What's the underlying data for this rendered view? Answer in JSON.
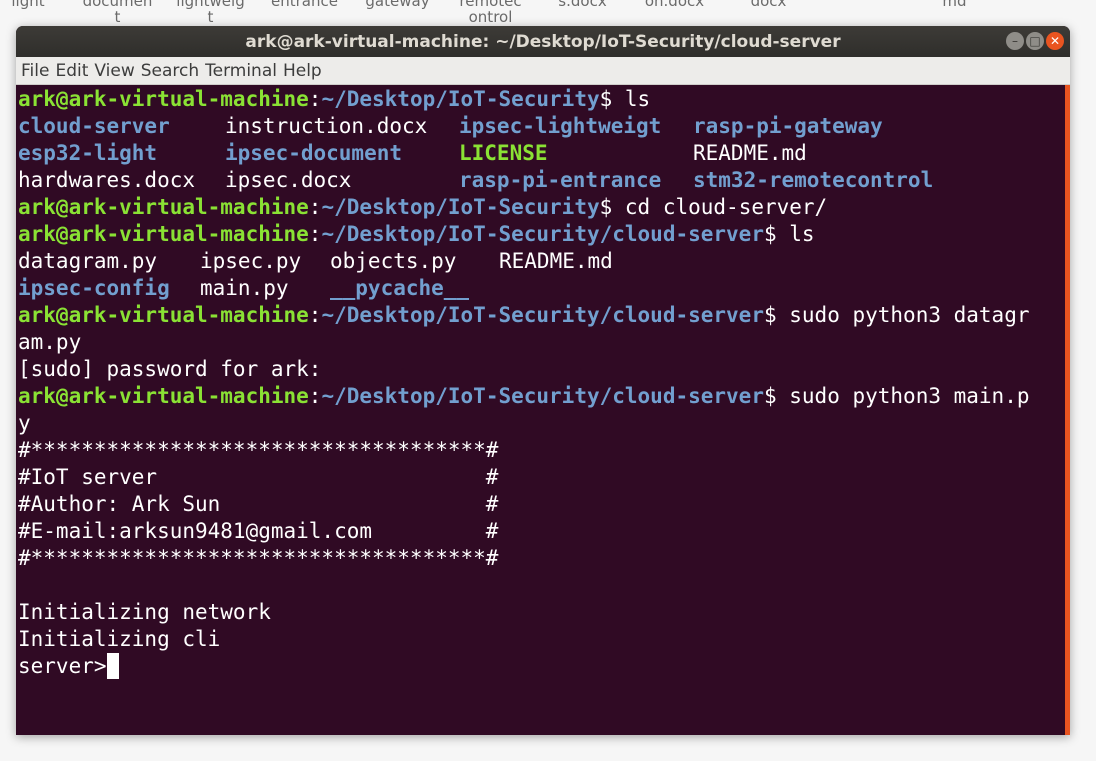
{
  "desktop_labels": [
    {
      "line1": "light",
      "line2": ""
    },
    {
      "line1": "documen",
      "line2": "t"
    },
    {
      "line1": "lightweig",
      "line2": "t"
    },
    {
      "line1": "entrance",
      "line2": ""
    },
    {
      "line1": "gateway",
      "line2": ""
    },
    {
      "line1": "remotec",
      "line2": "ontrol"
    },
    {
      "line1": "s.docx",
      "line2": ""
    },
    {
      "line1": "on.docx",
      "line2": ""
    },
    {
      "line1": "docx",
      "line2": ""
    },
    {
      "line1": "md",
      "line2": ""
    }
  ],
  "window": {
    "title": "ark@ark-virtual-machine: ~/Desktop/IoT-Security/cloud-server",
    "buttons": {
      "minimize": "–",
      "maximize": "□",
      "close": "✕"
    }
  },
  "menu": [
    "File",
    "Edit",
    "View",
    "Search",
    "Terminal",
    "Help"
  ],
  "terminal": {
    "user": "ark@ark-virtual-machine",
    "path_root": "~/Desktop/IoT-Security",
    "path_server": "~/Desktop/IoT-Security/cloud-server",
    "cmd1": " ls",
    "ls1": {
      "row1": [
        "cloud-server",
        "instruction.docx",
        "ipsec-lightweigt",
        "rasp-pi-gateway"
      ],
      "row2": [
        "esp32-light",
        "ipsec-document",
        "LICENSE",
        "README.md"
      ],
      "row3": [
        "hardwares.docx",
        "ipsec.docx",
        "rasp-pi-entrance",
        "stm32-remotecontrol"
      ]
    },
    "cmd2": " cd cloud-server/",
    "cmd3": " ls",
    "ls2": {
      "row1": [
        "datagram.py",
        "ipsec.py",
        "objects.py",
        "README.md"
      ],
      "row2": [
        "ipsec-config",
        "main.py",
        "__pycache__"
      ]
    },
    "cmd4_a": " sudo python3 datagr",
    "cmd4_b": "am.py",
    "sudo_prompt": "[sudo] password for ark:",
    "cmd5_a": " sudo python3 main.p",
    "cmd5_b": "y",
    "banner": [
      "#************************************#",
      "#IoT server                          #",
      "#Author: Ark Sun                     #",
      "#E-mail:arksun9481@gmail.com         #",
      "#************************************#"
    ],
    "output": [
      "Initializing network",
      "Initializing cli"
    ],
    "cli_prompt": "server>"
  },
  "colors": {
    "background": "#300a24",
    "user": "#8ae234",
    "path": "#729fcf",
    "accent": "#e95420"
  }
}
